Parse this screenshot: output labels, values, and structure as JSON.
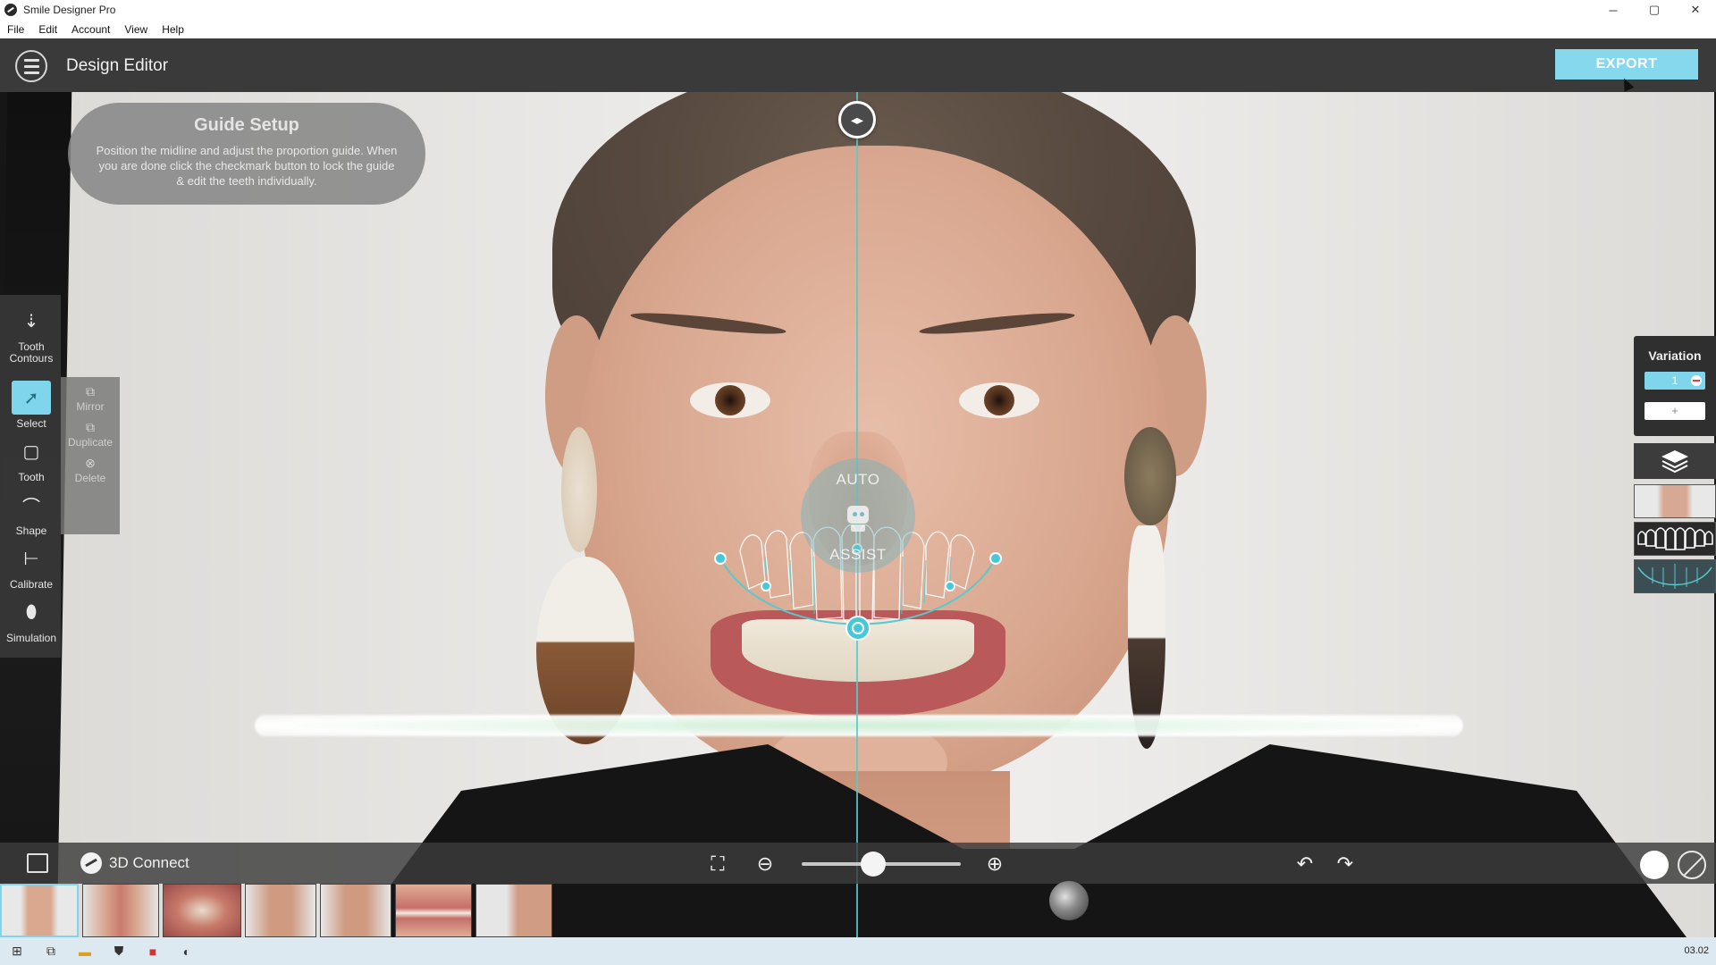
{
  "window": {
    "title": "Smile Designer Pro",
    "controls": [
      "minimize",
      "maximize",
      "close"
    ],
    "control_glyphs": [
      "─",
      "▢",
      "✕"
    ]
  },
  "menu": {
    "items": [
      "File",
      "Edit",
      "Account",
      "View",
      "Help"
    ]
  },
  "header": {
    "title": "Design Editor",
    "export_label": "EXPORT",
    "accent_color": "#86d8ec"
  },
  "guide_card": {
    "title": "Guide Setup",
    "body": "Position the midline and adjust the proportion guide. When you are done click the checkmark button to lock the guide & edit the teeth individually."
  },
  "canvas": {
    "auto_assist_top": "AUTO",
    "auto_assist_bottom": "ASSIST",
    "midline_color": "#5ac8cd"
  },
  "left_tools": [
    {
      "label": "Tooth Contours",
      "icon": "tooth-contours-icon"
    },
    {
      "label": "Select",
      "icon": "select-arrow-icon",
      "active": true
    },
    {
      "label": "Tooth",
      "icon": "tooth-outline-icon"
    },
    {
      "label": "Shape",
      "icon": "shape-curve-icon"
    },
    {
      "label": "Calibrate",
      "icon": "calibrate-ruler-icon"
    },
    {
      "label": "Simulation",
      "icon": "simulation-tooth-icon"
    }
  ],
  "sub_tools": [
    {
      "label": "Mirror",
      "icon": "mirror-icon"
    },
    {
      "label": "Duplicate",
      "icon": "duplicate-icon"
    },
    {
      "label": "Delete",
      "icon": "delete-icon"
    }
  ],
  "variation": {
    "title": "Variation",
    "selected": "1",
    "add_label": "+"
  },
  "bottom_bar": {
    "connect_label": "3D Connect",
    "zoom_level": 0.45
  },
  "thumbnails": [
    {
      "name": "face-front-smile",
      "selected": true
    },
    {
      "name": "face-retractor"
    },
    {
      "name": "occlusal-view"
    },
    {
      "name": "face-front-2"
    },
    {
      "name": "face-front-3"
    },
    {
      "name": "lips-closeup"
    },
    {
      "name": "face-profile"
    }
  ],
  "taskbar": {
    "clock": "03.02"
  }
}
